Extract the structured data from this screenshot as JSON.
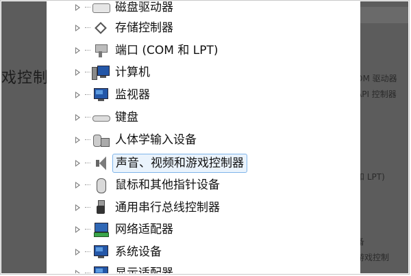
{
  "background": {
    "left_text": "戏控制",
    "right_texts": [
      "OM 驱动器",
      "API 控制器",
      "和 LPT)",
      "备",
      "游戏控制"
    ]
  },
  "device_tree": {
    "items": [
      {
        "label": "磁盘驱动器",
        "icon": "disk-drive-icon"
      },
      {
        "label": "存储控制器",
        "icon": "storage-controller-icon"
      },
      {
        "label": "端口 (COM 和 LPT)",
        "icon": "port-icon"
      },
      {
        "label": "计算机",
        "icon": "computer-icon"
      },
      {
        "label": "监视器",
        "icon": "monitor-icon"
      },
      {
        "label": "键盘",
        "icon": "keyboard-icon"
      },
      {
        "label": "人体学输入设备",
        "icon": "hid-icon"
      },
      {
        "label": "声音、视频和游戏控制器",
        "icon": "speaker-icon",
        "selected": true
      },
      {
        "label": "鼠标和其他指针设备",
        "icon": "mouse-icon"
      },
      {
        "label": "通用串行总线控制器",
        "icon": "usb-icon"
      },
      {
        "label": "网络适配器",
        "icon": "network-adapter-icon"
      },
      {
        "label": "系统设备",
        "icon": "system-device-icon"
      },
      {
        "label": "显示适配器",
        "icon": "display-adapter-icon"
      }
    ]
  },
  "colors": {
    "selection_border": "#7eb4ea",
    "selection_fill": "#eaf3fc",
    "dim_overlay": "#5c5c5c"
  }
}
